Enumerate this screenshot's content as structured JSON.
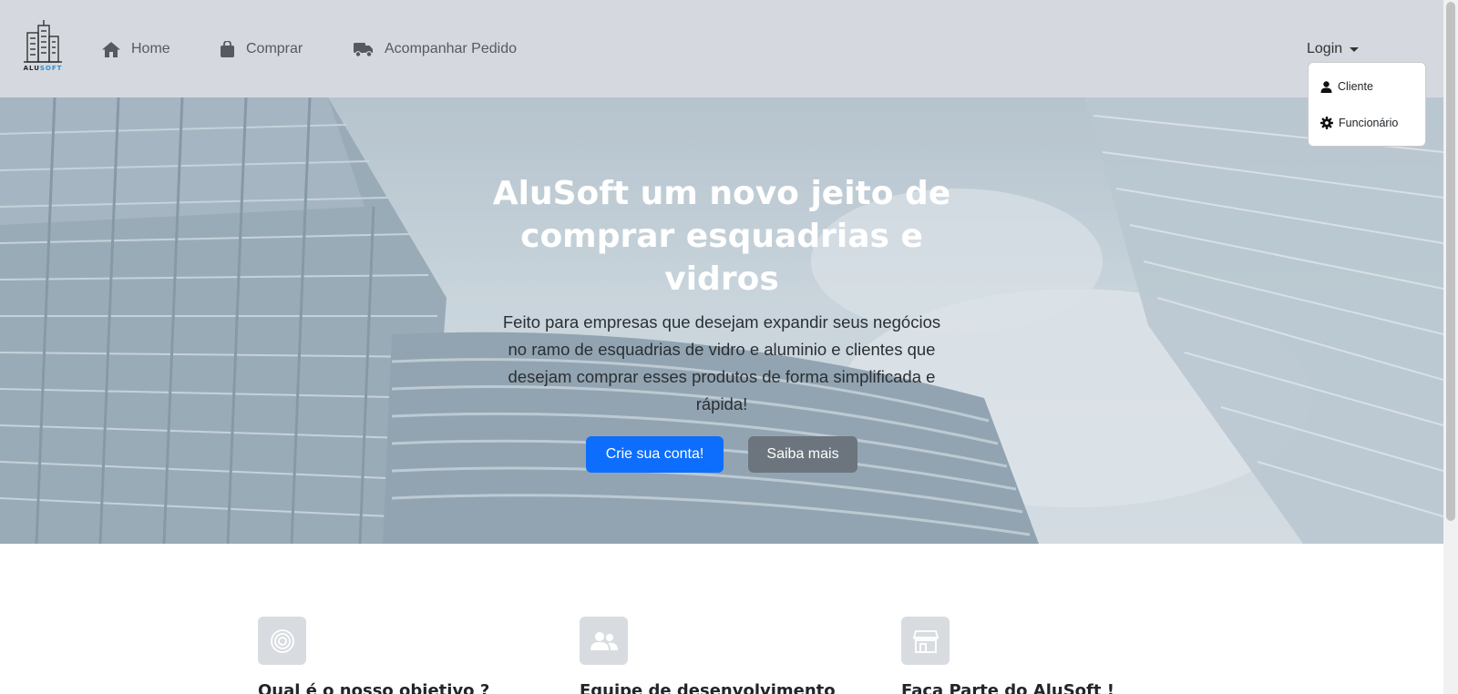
{
  "brand": {
    "logo_word": "ALU",
    "logo_word_accent": "SOFT",
    "logo_icon": "buildings-logo-icon"
  },
  "nav": {
    "items": [
      {
        "label": "Home",
        "icon": "home-icon"
      },
      {
        "label": "Comprar",
        "icon": "shopping-bag-icon"
      },
      {
        "label": "Acompanhar Pedido",
        "icon": "truck-icon"
      }
    ],
    "login_label": "Login",
    "login_menu": [
      {
        "label": "Cliente",
        "icon": "user-icon"
      },
      {
        "label": "Funcionário",
        "icon": "gear-icon"
      }
    ]
  },
  "hero": {
    "title": "AluSoft um novo jeito de comprar esquadrias e vidros",
    "text": "Feito para empresas que desejam expandir seus negócios no ramo de esquadrias de vidro e aluminio e clientes que desejam comprar esses produtos de forma simplificada e rápida!",
    "primary_button": "Crie sua conta!",
    "secondary_button": "Saiba mais"
  },
  "features": [
    {
      "title": "Qual é o nosso objetivo ?",
      "icon": "target-icon"
    },
    {
      "title": "Equipe de desenvolvimento",
      "icon": "team-icon"
    },
    {
      "title": "Faça Parte do AluSoft !",
      "icon": "store-icon"
    }
  ],
  "colors": {
    "navbar_bg": "#d5d9df",
    "primary": "#0d6efd",
    "secondary": "#6c757d",
    "feature_icon_bg": "#d8dce0"
  }
}
